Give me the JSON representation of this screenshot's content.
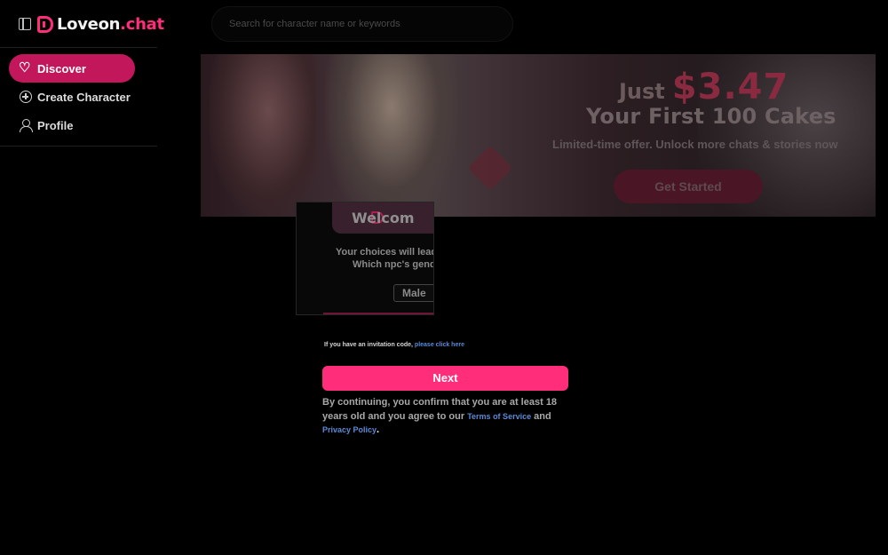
{
  "app": {
    "brand_part1": "Loveon",
    "brand_part2": ".chat",
    "brand_color": "#ff2d7a"
  },
  "sidebar": {
    "toggle_icon": "sidebar-toggle-icon",
    "items": [
      {
        "label": "Discover",
        "icon": "heart-icon",
        "active": true
      },
      {
        "label": "Create Character",
        "icon": "plus-circle-icon",
        "active": false
      },
      {
        "label": "Profile",
        "icon": "user-icon",
        "active": false
      }
    ]
  },
  "search": {
    "placeholder": "Search for character name or keywords",
    "value": ""
  },
  "banner": {
    "just": "Just",
    "price": "$3.47",
    "headline": "Your First 100 Cakes",
    "subtext": "Limited-time offer. Unlock more chats & stories now",
    "cta": "Get Started"
  },
  "welcome": {
    "title": "Welcom",
    "line1": "Your choices will lead t",
    "line2": "Which npc's gende",
    "gender_option": "Male"
  },
  "invite": {
    "text": "If you have an invitation code,",
    "link": "please click here"
  },
  "next_label": "Next",
  "consent": {
    "text": "By continuing, you confirm that you are at least 18 years old and you agree to our",
    "terms": "Terms of Service",
    "and": "and",
    "privacy": "Privacy Policy",
    "end": "."
  }
}
